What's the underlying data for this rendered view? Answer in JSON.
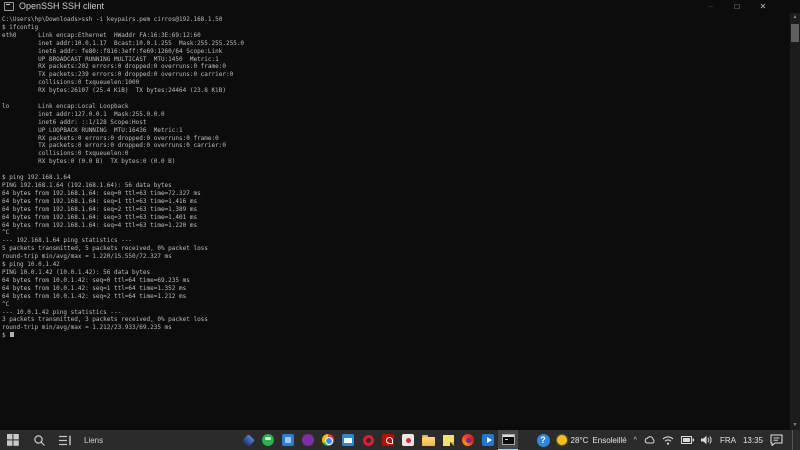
{
  "window": {
    "title": "OpenSSH SSH client",
    "controls": {
      "minimize": "–",
      "restore": "□",
      "close": "✕"
    }
  },
  "terminal": {
    "lines": [
      "C:\\Users\\hp\\Downloads>ssh -i keypairs.pem cirros@192.168.1.50",
      "$ ifconfig",
      "eth0      Link encap:Ethernet  HWaddr FA:16:3E:69:12:60",
      "          inet addr:10.0.1.17  Bcast:10.0.1.255  Mask:255.255.255.0",
      "          inet6 addr: fe80::f816:3eff:fe69:1260/64 Scope:Link",
      "          UP BROADCAST RUNNING MULTICAST  MTU:1450  Metric:1",
      "          RX packets:202 errors:0 dropped:0 overruns:0 frame:0",
      "          TX packets:239 errors:0 dropped:0 overruns:0 carrier:0",
      "          collisions:0 txqueuelen:1000",
      "          RX bytes:26107 (25.4 KiB)  TX bytes:24464 (23.8 KiB)",
      "",
      "lo        Link encap:Local Loopback",
      "          inet addr:127.0.0.1  Mask:255.0.0.0",
      "          inet6 addr: ::1/128 Scope:Host",
      "          UP LOOPBACK RUNNING  MTU:16436  Metric:1",
      "          RX packets:0 errors:0 dropped:0 overruns:0 frame:0",
      "          TX packets:0 errors:0 dropped:0 overruns:0 carrier:0",
      "          collisions:0 txqueuelen:0",
      "          RX bytes:0 (0.0 B)  TX bytes:0 (0.0 B)",
      "",
      "$ ping 192.168.1.64",
      "PING 192.168.1.64 (192.168.1.64): 56 data bytes",
      "64 bytes from 192.168.1.64: seq=0 ttl=63 time=72.327 ms",
      "64 bytes from 192.168.1.64: seq=1 ttl=63 time=1.416 ms",
      "64 bytes from 192.168.1.64: seq=2 ttl=63 time=1.389 ms",
      "64 bytes from 192.168.1.64: seq=3 ttl=63 time=1.401 ms",
      "64 bytes from 192.168.1.64: seq=4 ttl=63 time=1.220 ms",
      "^C",
      "--- 192.168.1.64 ping statistics ---",
      "5 packets transmitted, 5 packets received, 0% packet loss",
      "round-trip min/avg/max = 1.220/15.550/72.327 ms",
      "$ ping 10.0.1.42",
      "PING 10.0.1.42 (10.0.1.42): 56 data bytes",
      "64 bytes from 10.0.1.42: seq=0 ttl=64 time=69.235 ms",
      "64 bytes from 10.0.1.42: seq=1 ttl=64 time=1.352 ms",
      "64 bytes from 10.0.1.42: seq=2 ttl=64 time=1.212 ms",
      "^C",
      "--- 10.0.1.42 ping statistics ---",
      "3 packets transmitted, 3 packets received, 0% packet loss",
      "round-trip min/avg/max = 1.212/23.933/69.235 ms"
    ],
    "prompt": "$"
  },
  "scrollbar": {
    "up": "▲",
    "down": "▼"
  },
  "taskbar": {
    "toolbar_label": "Liens",
    "help_glyph": "?",
    "hidden_icons_glyph": "^",
    "weather": {
      "temp": "28°C",
      "condition": "Ensoleillé"
    },
    "language": "FRA",
    "time": "13:35",
    "apps": [
      "diamond-app",
      "green-app",
      "blue-app",
      "purple-app",
      "chrome",
      "mail",
      "opera",
      "acrobat",
      "white-red-app",
      "file-explorer",
      "sticky-notes",
      "red-swirl-app",
      "movies-tv",
      "openssh-terminal (active)"
    ]
  }
}
